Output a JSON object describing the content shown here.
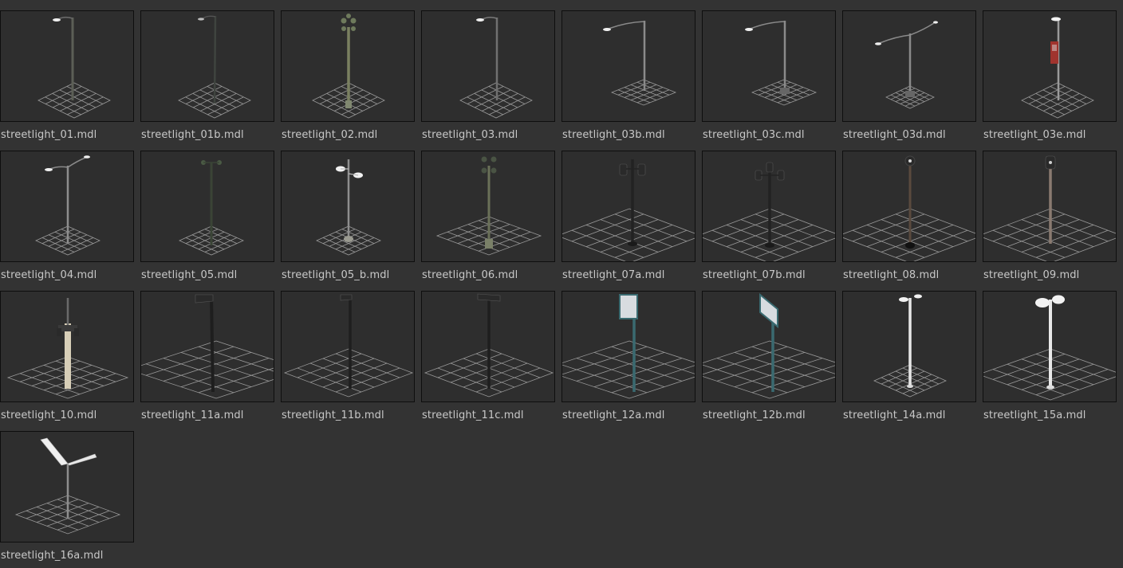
{
  "browser": {
    "items": [
      {
        "name": "streetlight_01.mdl"
      },
      {
        "name": "streetlight_01b.mdl"
      },
      {
        "name": "streetlight_02.mdl"
      },
      {
        "name": "streetlight_03.mdl"
      },
      {
        "name": "streetlight_03b.mdl"
      },
      {
        "name": "streetlight_03c.mdl"
      },
      {
        "name": "streetlight_03d.mdl"
      },
      {
        "name": "streetlight_03e.mdl"
      },
      {
        "name": "streetlight_04.mdl"
      },
      {
        "name": "streetlight_05.mdl"
      },
      {
        "name": "streetlight_05_b.mdl"
      },
      {
        "name": "streetlight_06.mdl"
      },
      {
        "name": "streetlight_07a.mdl"
      },
      {
        "name": "streetlight_07b.mdl"
      },
      {
        "name": "streetlight_08.mdl"
      },
      {
        "name": "streetlight_09.mdl"
      },
      {
        "name": "streetlight_10.mdl"
      },
      {
        "name": "streetlight_11a.mdl"
      },
      {
        "name": "streetlight_11b.mdl"
      },
      {
        "name": "streetlight_11c.mdl"
      },
      {
        "name": "streetlight_12a.mdl"
      },
      {
        "name": "streetlight_12b.mdl"
      },
      {
        "name": "streetlight_14a.mdl"
      },
      {
        "name": "streetlight_15a.mdl"
      },
      {
        "name": "streetlight_16a.mdl"
      }
    ]
  }
}
